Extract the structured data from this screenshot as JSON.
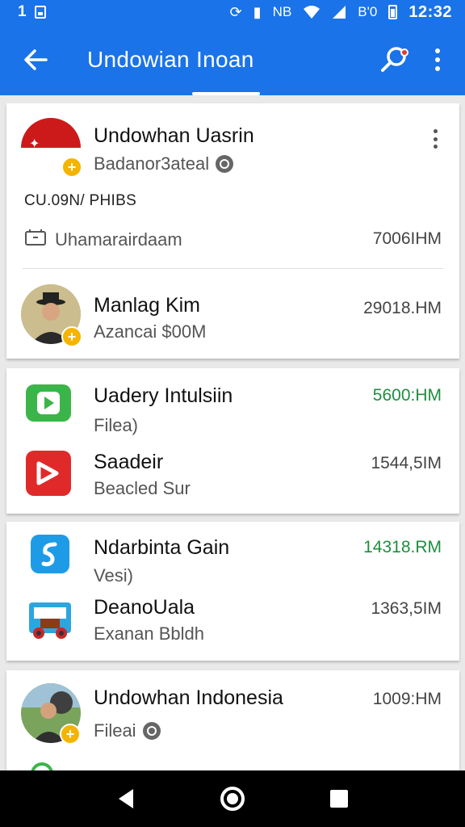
{
  "status_bar": {
    "left_number": "1",
    "carrier_text": "NB",
    "battery_text": "B'0",
    "time": "12:32"
  },
  "app_bar": {
    "title": "Undowian Inoan"
  },
  "account_card": {
    "name": "Undowhan Uasrin",
    "subtitle": "Badanor3ateal",
    "section_label": "CU.09N/ PHIBS",
    "wallet_label": "Uhamarairdaam",
    "wallet_amount": "7006IHM",
    "person_name": "Manlag Kim",
    "person_sub": "Azancai $00M",
    "person_amount": "29018.HM"
  },
  "apps_card_1": {
    "items": [
      {
        "name": "Uadery Intulsiin",
        "sub": "Filea)",
        "amount": "5600:HM",
        "icon": "green-play-icon"
      },
      {
        "name": "Saadeir",
        "sub": "Beacled Sur",
        "amount": "1544,5IM",
        "icon": "red-play-icon"
      }
    ]
  },
  "apps_card_2": {
    "items": [
      {
        "name": "Ndarbinta Gain",
        "sub": "Vesi)",
        "amount": "14318.RM",
        "icon": "blue-s-icon"
      },
      {
        "name": "DeanoUala",
        "sub": "Exanan Bbldh",
        "amount": "1363,5IM",
        "icon": "bus-icon"
      }
    ]
  },
  "bottom_card": {
    "name": "Undowhan Indonesia",
    "sub": "Fileai",
    "amount": "1009:HM"
  },
  "colors": {
    "primary": "#1a73e8",
    "accent_green": "#1e8e3e",
    "badge_yellow": "#f5b400"
  }
}
